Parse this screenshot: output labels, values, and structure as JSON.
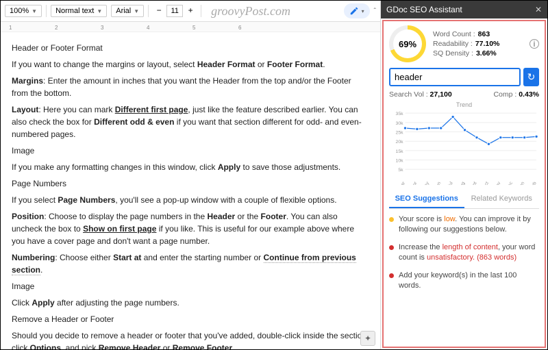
{
  "toolbar": {
    "zoom": "100%",
    "style": "Normal text",
    "font": "Arial",
    "fontsize": "11",
    "watermark": "groovyPost.com"
  },
  "doc": {
    "h1": "Header or Footer Format",
    "p1a": "If you want to change the margins or layout, select ",
    "p1b": "Header Format",
    "p1c": " or ",
    "p1d": "Footer Format",
    "p1e": ".",
    "p2a": "Margins",
    "p2b": ": Enter the amount in inches that you want the Header from the top and/or the Footer from the bottom.",
    "p3a": "Layout",
    "p3b": ": Here you can mark ",
    "p3c": "Different first page",
    "p3d": ", just like the feature described earlier. You can also check the box for ",
    "p3e": "Different odd & even",
    "p3f": " if you want that section different for odd- and even-numbered pages.",
    "p4": "Image",
    "p5a": "If you make any formatting changes in this window, click ",
    "p5b": "Apply",
    "p5c": " to save those adjustments.",
    "p6": "Page Numbers",
    "p7a": "If you select ",
    "p7b": "Page Numbers",
    "p7c": ", you'll see a pop-up window with a couple of flexible options.",
    "p8a": "Position",
    "p8b": ": Choose to display the page numbers in the ",
    "p8c": "Header",
    "p8d": " or the ",
    "p8e": "Footer",
    "p8f": ". You can also uncheck the box to ",
    "p8g": "Show on first page",
    "p8h": " if you like. This is useful for our example above where you have a cover page and don't want a page number.",
    "p9a": "Numbering",
    "p9b": ": Choose either ",
    "p9c": "Start at",
    "p9d": " and enter the starting number or ",
    "p9e": "Continue from previous section",
    "p9f": ".",
    "p10": "Image",
    "p11a": "Click ",
    "p11b": "Apply",
    "p11c": " after adjusting the page numbers.",
    "p12": "Remove a Header or Footer",
    "p13a": "Should you decide to remove a header or footer that you've added, double-click inside the section, click ",
    "p13b": "Options",
    "p13c": ", and pick ",
    "p13d": "Remove Header",
    "p13e": " or ",
    "p13f": "Remove Footer",
    "p13g": "."
  },
  "seo": {
    "title": "GDoc SEO Assistant",
    "score": "69%",
    "wc_label": "Word Count :",
    "wc": "863",
    "rd_label": "Readability :",
    "rd": "77.10%",
    "sq_label": "SQ Density :",
    "sq": "3.66%",
    "keyword": "header",
    "sv_label": "Search Vol :",
    "sv": "27,100",
    "cp_label": "Comp :",
    "cp": "0.43%",
    "trend": "Trend",
    "tab1": "SEO Suggestions",
    "tab2": "Related Keywords",
    "s1a": "Your score is ",
    "s1b": "low",
    "s1c": ". You can improve it by following our suggestions below.",
    "s2a": "Increase the ",
    "s2b": "length of content",
    "s2c": ", your word count is ",
    "s2d": "unsatisfactory. (863 words)",
    "s3": "Add your keyword(s) in the last 100 words."
  },
  "chart_data": {
    "type": "line",
    "title": "Trend",
    "categories": [
      "Mar",
      "Apr",
      "May",
      "Jun",
      "Jul",
      "Aug",
      "Sept",
      "Oct",
      "Nov",
      "Dec",
      "Jan",
      "Feb"
    ],
    "values": [
      27000,
      26500,
      27000,
      27000,
      33000,
      26000,
      22000,
      18500,
      22000,
      22000,
      22000,
      22500
    ],
    "ylabel": "",
    "xlabel": "",
    "yticks": [
      5000,
      10000,
      15000,
      20000,
      25000,
      30000,
      35000
    ],
    "ytick_labels": [
      "5k",
      "10k",
      "15k",
      "20k",
      "25k",
      "30k",
      "35k"
    ],
    "ylim": [
      5000,
      35000
    ]
  }
}
